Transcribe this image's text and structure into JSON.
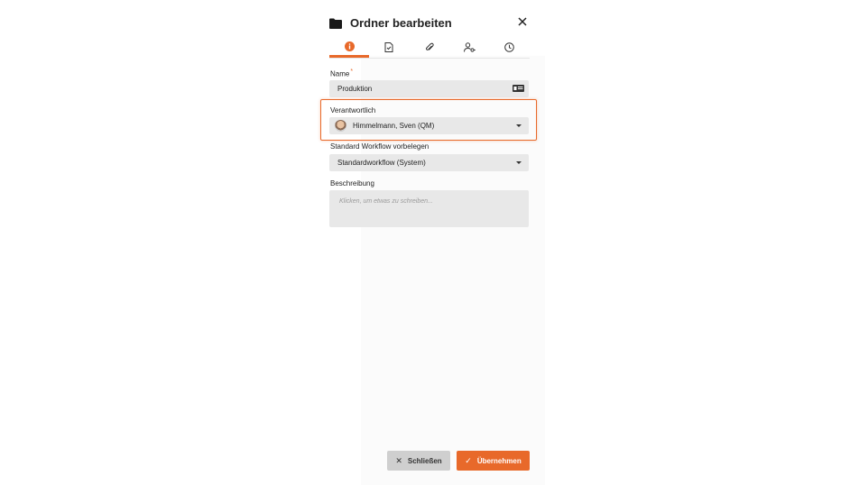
{
  "dialog": {
    "title": "Ordner bearbeiten",
    "icon": "folder-icon",
    "close_icon": "close-icon"
  },
  "tabs": [
    {
      "icon": "info-icon",
      "active": true
    },
    {
      "icon": "document-check-icon",
      "active": false
    },
    {
      "icon": "paperclip-icon",
      "active": false
    },
    {
      "icon": "user-key-icon",
      "active": false
    },
    {
      "icon": "clock-icon",
      "active": false
    }
  ],
  "form": {
    "name": {
      "label": "Name",
      "required_mark": "*",
      "value": "Produktion"
    },
    "responsible": {
      "label": "Verantwortlich",
      "value": "Himmelmann, Sven (QM)"
    },
    "workflow": {
      "label": "Standard Workflow vorbelegen",
      "value": "Standardworkflow (System)"
    },
    "description": {
      "label": "Beschreibung",
      "placeholder": "Klicken, um etwas zu schreiben..."
    }
  },
  "buttons": {
    "close": {
      "label": "Schließen",
      "glyph": "✕"
    },
    "apply": {
      "label": "Übernehmen",
      "glyph": "✓"
    }
  },
  "colors": {
    "accent": "#e8692a",
    "field_bg": "#e8e8e8",
    "secondary_button": "#cfcfcf"
  }
}
